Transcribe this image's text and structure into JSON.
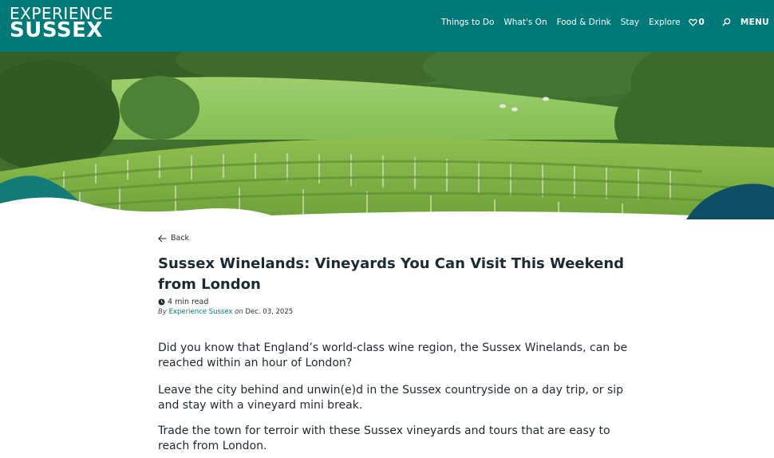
{
  "header": {
    "logo_line1": "EXPERIENCE",
    "logo_line2": "SUSSEX",
    "nav": [
      "Things to Do",
      "What's On",
      "Food & Drink",
      "Stay",
      "Explore"
    ],
    "favourites_count": "0",
    "menu_label": "MENU",
    "icons": {
      "favourites": "heart-icon",
      "search": "search-icon"
    }
  },
  "hero": {
    "alt_subject": "vineyard-rows-countryside-image"
  },
  "article": {
    "back_label": "Back",
    "title": "Sussex Winelands: Vineyards You Can Visit This Weekend from London",
    "read_time": "4 min read",
    "byline_prefix": "By",
    "author": "Experience Sussex",
    "date_prefix": "on",
    "date": "Dec. 03, 2025",
    "paragraphs": [
      "Did you know that England’s world-class wine region, the Sussex Winelands, can be reached within an hour of London?",
      "Leave the city behind and unwin(e)d in the Sussex countryside on a day trip, or sip and stay with a vineyard mini break.",
      "Trade the town for terroir with these Sussex vineyards and tours that are easy to reach from London."
    ]
  },
  "colors": {
    "brand": "#007a78",
    "accent_dark": "#0e4e66",
    "text": "#1f2a30"
  }
}
